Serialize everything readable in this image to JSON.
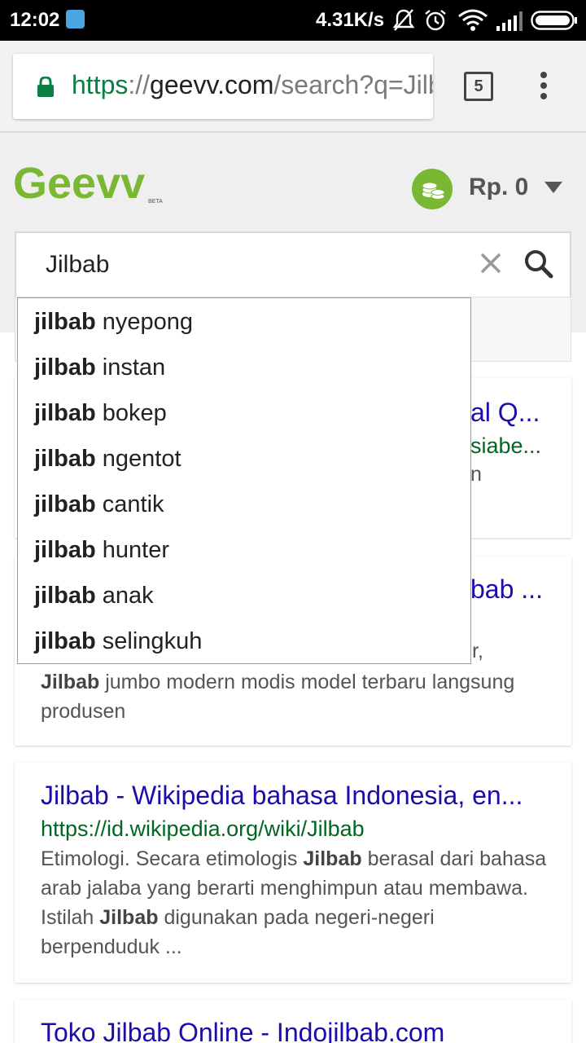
{
  "status_bar": {
    "time": "12:02",
    "speed": "4.31K/s"
  },
  "browser": {
    "url_scheme": "https",
    "url_sep": "://",
    "url_host": "geevv.com",
    "url_path": "/search?q=Jilbab",
    "tab_count": "5"
  },
  "header": {
    "logo": "Geevv",
    "logo_badge": "BETA",
    "balance": "Rp. 0"
  },
  "search": {
    "value": "Jilbab"
  },
  "suggestions": [
    {
      "prefix": "jilbab",
      "rest": " nyepong"
    },
    {
      "prefix": "jilbab",
      "rest": " instan"
    },
    {
      "prefix": "jilbab",
      "rest": " bokep"
    },
    {
      "prefix": "jilbab",
      "rest": " ngentot"
    },
    {
      "prefix": "jilbab",
      "rest": " cantik"
    },
    {
      "prefix": "jilbab",
      "rest": " hunter"
    },
    {
      "prefix": "jilbab",
      "rest": " anak"
    },
    {
      "prefix": "jilbab",
      "rest": " selingkuh"
    }
  ],
  "results": [
    {
      "title_fragment": "al Q...",
      "url_fragment": "siabe...",
      "snippet_fragment": "n"
    },
    {
      "title_fragment": "bab ...",
      "snippet_fragment": "r,",
      "snippet_bold": "Jilbab",
      "snippet_line2": " jumbo modern modis model terbaru langsung",
      "snippet_line3": "produsen"
    },
    {
      "title": "Jilbab - Wikipedia bahasa Indonesia, en...",
      "url": "https://id.wikipedia.org/wiki/Jilbab",
      "s1": "Etimologi. Secara etimologis ",
      "s1_bold": "Jilbab",
      "s2": " berasal dari bahasa arab jalaba yang berarti menghimpun atau membawa. Istilah ",
      "s2_bold": "Jilbab",
      "s3": " digunakan pada negeri-negeri berpenduduk ..."
    },
    {
      "title": "Toko Jilbab Online - Indojilbab.com"
    }
  ],
  "colors": {
    "link": "#1a0dab",
    "url": "#006621",
    "brand_green": "#7ab833"
  }
}
